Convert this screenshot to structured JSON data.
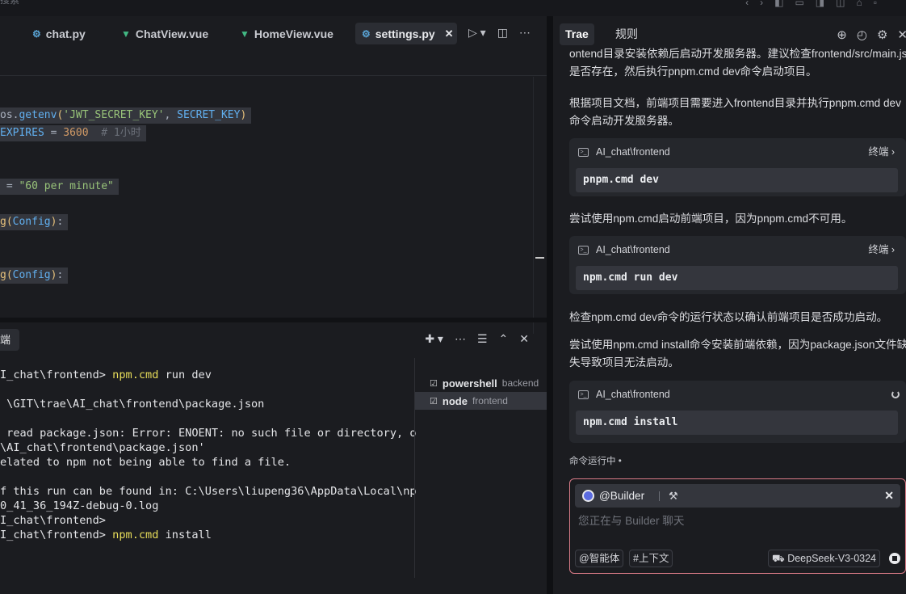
{
  "topbar": {
    "ghost_text": "搜索",
    "controls": [
      "◧",
      "▭",
      "◨",
      "◫",
      "⌂",
      "▫"
    ]
  },
  "editor": {
    "tabs": [
      {
        "label": "chat.py",
        "icon": "python-icon",
        "active": false
      },
      {
        "label": "ChatView.vue",
        "icon": "vue-icon",
        "active": false
      },
      {
        "label": "HomeView.vue",
        "icon": "vue-icon",
        "active": false
      },
      {
        "label": "settings.py",
        "icon": "python-icon",
        "active": true
      }
    ],
    "close_glyph": "✕",
    "code_lines": [
      {
        "parts": [
          {
            "t": "os.",
            "c": "c-plain"
          },
          {
            "t": "getenv",
            "c": "c-id"
          },
          {
            "t": "(",
            "c": "c-fn"
          },
          {
            "t": "'JWT_SECRET_KEY'",
            "c": "c-str"
          },
          {
            "t": ", ",
            "c": "c-plain"
          },
          {
            "t": "SECRET_KEY",
            "c": "c-id"
          },
          {
            "t": ")",
            "c": "c-fn"
          }
        ]
      },
      {
        "parts": [
          {
            "t": "EXPIRES",
            "c": "c-id"
          },
          {
            "t": " = ",
            "c": "c-plain"
          },
          {
            "t": "3600",
            "c": "c-num"
          },
          {
            "t": "  # 1小时",
            "c": "c-cmt"
          }
        ]
      },
      {
        "parts": [
          {
            "t": " = ",
            "c": "c-plain"
          },
          {
            "t": "\"60 per minute\"",
            "c": "c-str"
          }
        ]
      },
      {
        "parts": [
          {
            "t": "g",
            "c": "c-fn"
          },
          {
            "t": "(",
            "c": "c-fn"
          },
          {
            "t": "Config",
            "c": "c-id"
          },
          {
            "t": ")",
            "c": "c-fn"
          },
          {
            "t": ":",
            "c": "c-plain"
          }
        ]
      },
      {
        "parts": [
          {
            "t": "g",
            "c": "c-fn"
          },
          {
            "t": "(",
            "c": "c-fn"
          },
          {
            "t": "Config",
            "c": "c-id"
          },
          {
            "t": ")",
            "c": "c-fn"
          },
          {
            "t": ":",
            "c": "c-plain"
          }
        ]
      }
    ]
  },
  "terminal": {
    "tab_label": "端",
    "lines": [
      {
        "pre": "I_chat\\frontend> ",
        "cmd": "npm.cmd",
        "post": " run dev"
      },
      {
        "pre": "",
        "cmd": "",
        "post": ""
      },
      {
        "pre": " \\GIT\\trae\\AI_chat\\frontend\\package.json",
        "cmd": "",
        "post": ""
      },
      {
        "pre": "",
        "cmd": "",
        "post": ""
      },
      {
        "pre": " read package.json: Error: ENOENT: no such file or directory, o",
        "cmd": "",
        "post": ""
      },
      {
        "pre": "\\AI_chat\\frontend\\package.json'",
        "cmd": "",
        "post": ""
      },
      {
        "pre": "elated to npm not being able to find a file.",
        "cmd": "",
        "post": ""
      },
      {
        "pre": "",
        "cmd": "",
        "post": ""
      },
      {
        "pre": "f this run can be found in: C:\\Users\\liupeng36\\AppData\\Local\\np",
        "cmd": "",
        "post": ""
      },
      {
        "pre": "0_41_36_194Z-debug-0.log",
        "cmd": "",
        "post": ""
      },
      {
        "pre": "I_chat\\frontend>",
        "cmd": "",
        "post": ""
      },
      {
        "pre": "I_chat\\frontend> ",
        "cmd": "npm.cmd",
        "post": " install"
      }
    ],
    "sessions": [
      {
        "name": "powershell",
        "sub": "backend",
        "selected": false
      },
      {
        "name": "node",
        "sub": "frontend",
        "selected": true
      }
    ]
  },
  "chat": {
    "tabs": [
      {
        "label": "Trae",
        "active": true
      },
      {
        "label": "规则",
        "active": false
      }
    ],
    "messages": {
      "m0_l1": "ontend目录安装依赖后启动开发服务器。建议检查frontend/src/main.js",
      "m0_l2": "是否存在，然后执行pnpm.cmd dev命令启动项目。",
      "m1_l1": "根据项目文档，前端项目需要进入frontend目录并执行pnpm.cmd dev",
      "m1_l2": "命令启动开发服务器。",
      "m2": "尝试使用npm.cmd启动前端项目，因为pnpm.cmd不可用。",
      "m3": "检查npm.cmd dev命令的运行状态以确认前端项目是否成功启动。",
      "m4_l1": "尝试使用npm.cmd install命令安装前端依赖，因为package.json文件缺",
      "m4_l2": "失导致项目无法启动。"
    },
    "cards": [
      {
        "path": "AI_chat\\frontend",
        "action": "终端 ›",
        "command": "pnpm.cmd dev"
      },
      {
        "path": "AI_chat\\frontend",
        "action": "终端 ›",
        "command": "npm.cmd run dev"
      },
      {
        "path": "AI_chat\\frontend",
        "action": "",
        "command": "npm.cmd install"
      }
    ],
    "running_status": "命令运行中  •",
    "input": {
      "agent": "@Builder",
      "placeholder": "您正在与 Builder 聊天",
      "agent_btn": "@智能体",
      "context_btn": "#上下文",
      "model": "DeepSeek-V3-0324"
    }
  },
  "colors": {
    "accent_border": "#d97b87",
    "terminal_cmd": "#e8dd5a",
    "vue_green": "#42b883",
    "python_blue": "#5aa6d8"
  }
}
